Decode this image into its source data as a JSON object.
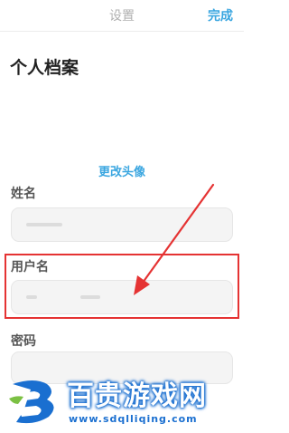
{
  "navbar": {
    "title": "设置",
    "done_label": "完成"
  },
  "profile": {
    "title": "个人档案",
    "change_avatar_label": "更改头像"
  },
  "fields": {
    "name_label": "姓名",
    "username_label": "用户名",
    "password_label": "密码"
  },
  "watermark": {
    "name": "百贵游戏网",
    "url": "www.sdqlliqing.com"
  },
  "colors": {
    "accent": "#3aa6e0",
    "highlight": "#e53333",
    "watermark": "#1a6fd0"
  }
}
